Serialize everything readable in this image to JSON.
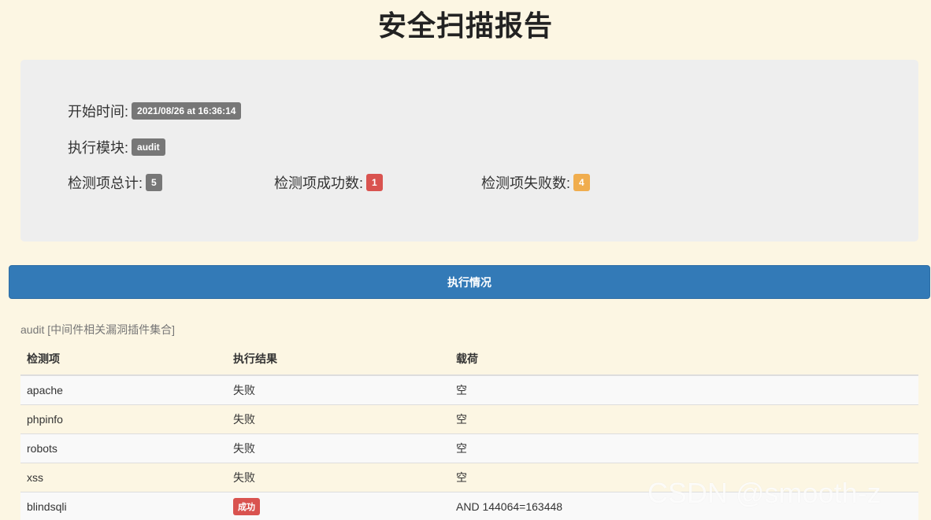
{
  "title": "安全扫描报告",
  "summary": {
    "start_label": "开始时间:",
    "start_value": "2021/08/26 at 16:36:14",
    "module_label": "执行模块:",
    "module_value": "audit",
    "total_label": "检测项总计:",
    "total_value": "5",
    "success_label": "检测项成功数:",
    "success_value": "1",
    "fail_label": "检测项失败数:",
    "fail_value": "4"
  },
  "section_bar": "执行情况",
  "caption": "audit [中间件相关漏洞插件集合]",
  "table": {
    "headers": [
      "检测项",
      "执行结果",
      "载荷"
    ],
    "rows": [
      {
        "item": "apache",
        "result": "失败",
        "payload": "空"
      },
      {
        "item": "phpinfo",
        "result": "失败",
        "payload": "空"
      },
      {
        "item": "robots",
        "result": "失败",
        "payload": "空"
      },
      {
        "item": "xss",
        "result": "失败",
        "payload": "空"
      },
      {
        "item": "blindsqli",
        "result": "成功",
        "payload": "AND 144064=163448"
      }
    ]
  },
  "watermark": "CSDN @smooth-z",
  "colors": {
    "page_bg": "#fcf6e3",
    "panel_bg": "#eeeeee",
    "primary": "#337ab7",
    "badge_default": "#777777",
    "badge_danger": "#d9534f",
    "badge_warning": "#f0ad4e"
  }
}
